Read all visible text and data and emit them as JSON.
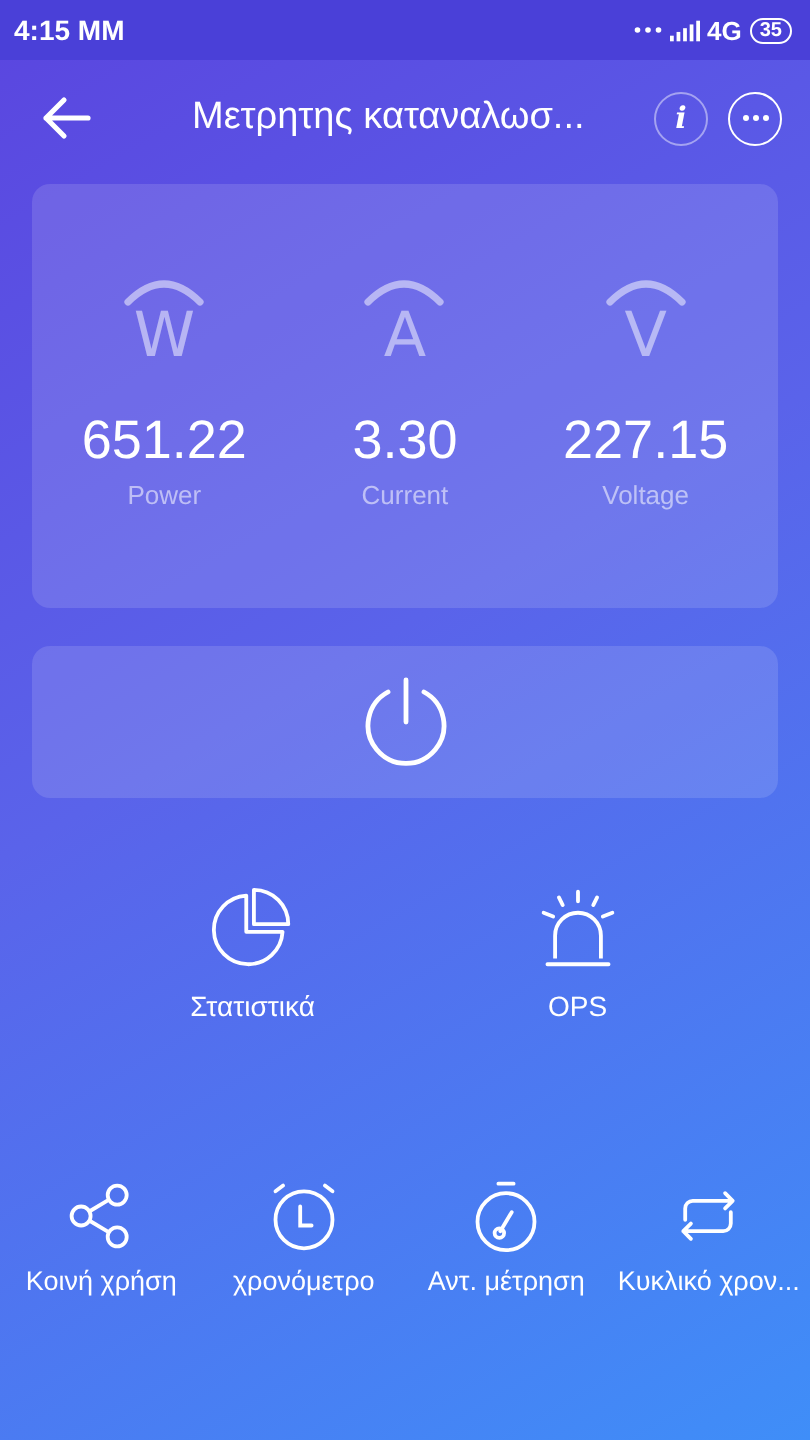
{
  "status_bar": {
    "time": "4:15 MM",
    "network": "4G",
    "battery": "35"
  },
  "header": {
    "title": "Μετρητης καταναλωσ...",
    "info_label": "i"
  },
  "meters": [
    {
      "symbol": "W",
      "value": "651.22",
      "label": "Power"
    },
    {
      "symbol": "A",
      "value": "3.30",
      "label": "Current"
    },
    {
      "symbol": "V",
      "value": "227.15",
      "label": "Voltage"
    }
  ],
  "features": [
    {
      "label": "Στατιστικά"
    },
    {
      "label": "OPS"
    }
  ],
  "actions": [
    {
      "label": "Κοινή χρήση"
    },
    {
      "label": "χρονόμετρο"
    },
    {
      "label": "Αντ. μέτρηση"
    },
    {
      "label": "Κυκλικό χρον..."
    }
  ]
}
